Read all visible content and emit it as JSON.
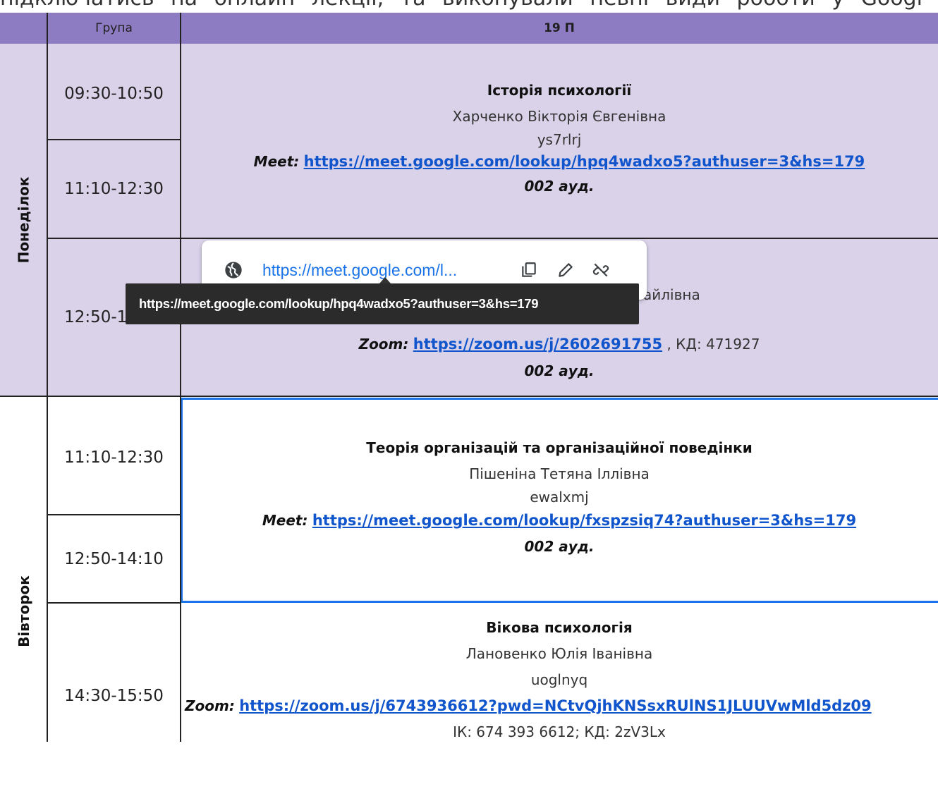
{
  "page_top_text": "підключатись на онлайн лекції, та виконували певні види роботи у Googl",
  "table": {
    "header_group_label": "Група",
    "header_group_name": "19 П",
    "days": [
      {
        "name": "Понеділок",
        "slots": [
          "09:30-10:50",
          "11:10-12:30",
          "12:50-14:10"
        ],
        "lessons": [
          {
            "subject": "Історія психології",
            "teacher": "Харченко Вікторія Євгенівна",
            "code": "ys7rlrj",
            "link_label": "Meet:",
            "link": "https://meet.google.com/lookup/hpq4wadxo5?authuser=3&hs=179",
            "room": "002 ауд."
          },
          {
            "teacher_partial": "айлівна",
            "link_label": "Zoom:",
            "link": "https://zoom.us/j/2602691755",
            "link_suffix": ", КД: 471927",
            "room": "002 ауд."
          }
        ]
      },
      {
        "name": "Вівторок",
        "slots": [
          "11:10-12:30",
          "12:50-14:10",
          "14:30-15:50"
        ],
        "lessons": [
          {
            "subject": "Теорія організацій та організаційної поведінки",
            "teacher": "Пішеніна Тетяна Іллівна",
            "code": "ewalxmj",
            "link_label": "Meet:",
            "link": "https://meet.google.com/lookup/fxspzsiq74?authuser=3&hs=179",
            "room": "002 ауд."
          },
          {
            "subject": "Вікова психологія",
            "teacher": "Лановенко Юлія Іванівна",
            "code": "uoglnyq",
            "link_label": "Zoom:",
            "link": "https://zoom.us/j/6743936612?pwd=NCtvQjhKNSsxRUlNS1JLUUVwMld5dz09",
            "extra": "ІК: 674 393 6612; КД: 2zV3Lx"
          }
        ]
      }
    ]
  },
  "link_popup": {
    "display_url": "https://meet.google.com/l...",
    "icons": [
      "globe-icon",
      "copy-icon",
      "edit-icon",
      "unlink-icon"
    ]
  },
  "tooltip": {
    "text": "https://meet.google.com/lookup/hpq4wadxo5?authuser=3&hs=179"
  },
  "colors": {
    "header_bg": "#8e7cc3",
    "monday_bg": "#d9d2e9",
    "link": "#1155cc",
    "selection_border": "#1a73e8",
    "tooltip_bg": "#2b2b2b"
  }
}
